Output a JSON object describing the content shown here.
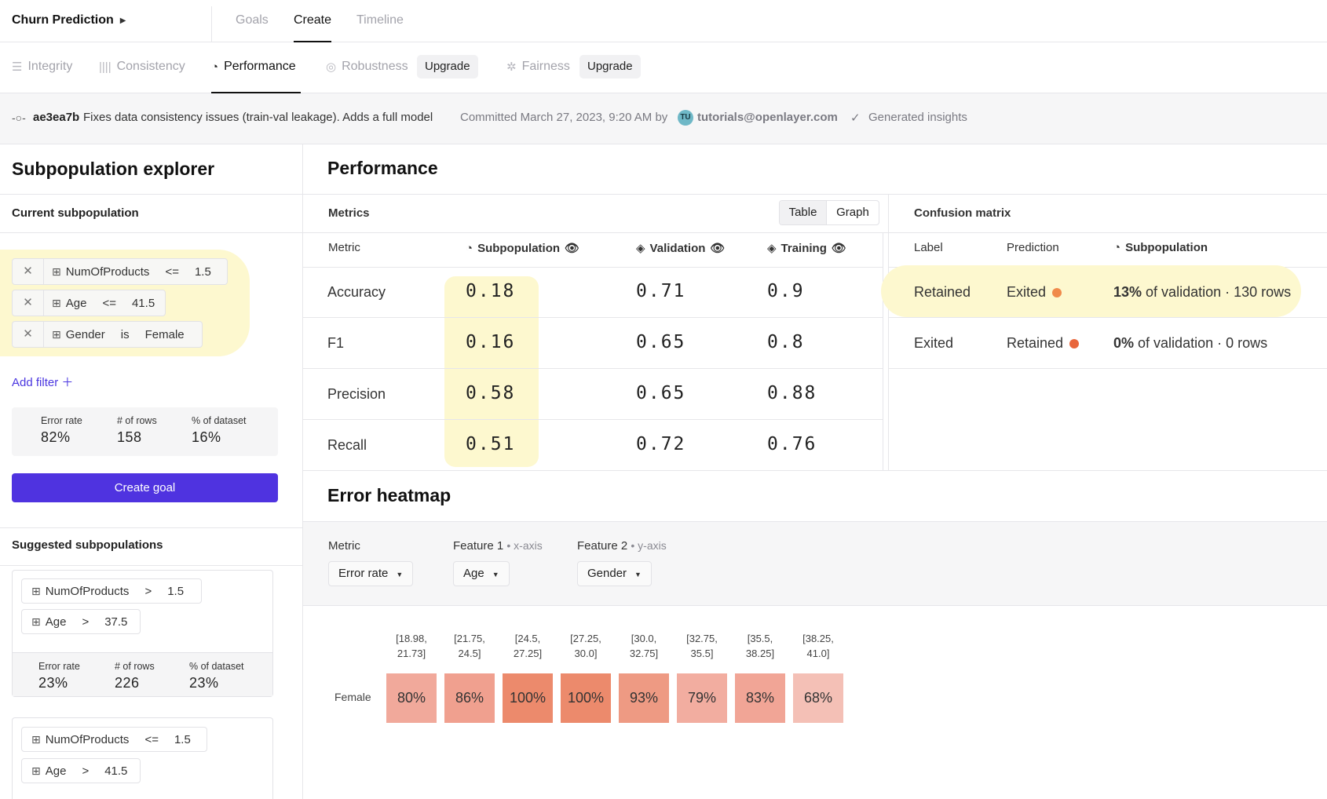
{
  "project": {
    "name": "Churn Prediction"
  },
  "top_tabs": [
    {
      "label": "Goals",
      "active": false
    },
    {
      "label": "Create",
      "active": true
    },
    {
      "label": "Timeline",
      "active": false
    }
  ],
  "sub_tabs": [
    {
      "label": "Integrity",
      "icon": "lines-icon",
      "active": false
    },
    {
      "label": "Consistency",
      "icon": "bars-icon",
      "active": false
    },
    {
      "label": "Performance",
      "icon": "pie-icon",
      "active": true
    },
    {
      "label": "Robustness",
      "icon": "target-icon",
      "active": false,
      "upgrade": "Upgrade"
    },
    {
      "label": "Fairness",
      "icon": "aperture-icon",
      "active": false,
      "upgrade": "Upgrade"
    }
  ],
  "commit": {
    "hash": "ae3ea7b",
    "message": "Fixes data consistency issues (train-val leakage). Adds a full model",
    "committed": "Committed March 27, 2023, 9:20 AM",
    "by": "by",
    "avatar_initials": "TU",
    "user": "tutorials@openlayer.com",
    "status": "Generated insights"
  },
  "left": {
    "title": "Subpopulation explorer",
    "current_label": "Current subpopulation",
    "filters": [
      {
        "feature": "NumOfProducts",
        "op": "<=",
        "value": "1.5"
      },
      {
        "feature": "Age",
        "op": "<=",
        "value": "41.5"
      },
      {
        "feature": "Gender",
        "op": "is",
        "value": "Female"
      }
    ],
    "add_filter": "Add filter",
    "stats": {
      "error_rate_label": "Error rate",
      "error_rate": "82%",
      "rows_label": "# of rows",
      "rows": "158",
      "pct_label": "% of dataset",
      "pct": "16%"
    },
    "create_goal": "Create goal",
    "suggested_label": "Suggested subpopulations",
    "suggested": [
      {
        "filters": [
          {
            "feature": "NumOfProducts",
            "op": ">",
            "value": "1.5"
          },
          {
            "feature": "Age",
            "op": ">",
            "value": "37.5"
          }
        ],
        "error_rate_label": "Error rate",
        "error_rate": "23%",
        "rows_label": "# of rows",
        "rows": "226",
        "pct_label": "% of dataset",
        "pct": "23%"
      },
      {
        "filters": [
          {
            "feature": "NumOfProducts",
            "op": "<=",
            "value": "1.5"
          },
          {
            "feature": "Age",
            "op": ">",
            "value": "41.5"
          }
        ]
      }
    ]
  },
  "performance": {
    "title": "Performance",
    "metrics_label": "Metrics",
    "toggle": {
      "table": "Table",
      "graph": "Graph"
    },
    "columns": {
      "metric": "Metric",
      "subpopulation": "Subpopulation",
      "validation": "Validation",
      "training": "Training"
    },
    "rows": [
      {
        "name": "Accuracy",
        "sub": "0.18",
        "val": "0.71",
        "train": "0.9"
      },
      {
        "name": "F1",
        "sub": "0.16",
        "val": "0.65",
        "train": "0.8"
      },
      {
        "name": "Precision",
        "sub": "0.58",
        "val": "0.65",
        "train": "0.88"
      },
      {
        "name": "Recall",
        "sub": "0.51",
        "val": "0.72",
        "train": "0.76"
      }
    ]
  },
  "confusion": {
    "title": "Confusion matrix",
    "columns": {
      "label": "Label",
      "prediction": "Prediction",
      "subpopulation": "Subpopulation"
    },
    "rows": [
      {
        "label": "Retained",
        "prediction": "Exited",
        "pct": "13%",
        "text": "of validation · 130 rows"
      },
      {
        "label": "Exited",
        "prediction": "Retained",
        "pct": "0%",
        "text": "of validation · 0 rows"
      }
    ]
  },
  "heatmap": {
    "title": "Error heatmap",
    "metric_label": "Metric",
    "metric_value": "Error rate",
    "feature1_label": "Feature 1",
    "feature1_axis": "• x-axis",
    "feature1_value": "Age",
    "feature2_label": "Feature 2",
    "feature2_axis": "• y-axis",
    "feature2_value": "Gender",
    "row_label": "Female",
    "bins": [
      [
        "[18.98,",
        "21.73]"
      ],
      [
        "[21.75,",
        "24.5]"
      ],
      [
        "[24.5,",
        "27.25]"
      ],
      [
        "[27.25,",
        "30.0]"
      ],
      [
        "[30.0,",
        "32.75]"
      ],
      [
        "[32.75,",
        "35.5]"
      ],
      [
        "[35.5,",
        "38.25]"
      ],
      [
        "[38.25,",
        "41.0]"
      ]
    ],
    "values": [
      "80%",
      "86%",
      "100%",
      "100%",
      "93%",
      "79%",
      "83%",
      "68%"
    ],
    "colors": [
      "#f1a99b",
      "#f0a08f",
      "#ec8a6c",
      "#ec8a6c",
      "#ee9a83",
      "#f2ada0",
      "#f1a596",
      "#f4c0b6"
    ]
  },
  "colors": {
    "accent": "#4f33e0",
    "highlight": "#fdf8cf",
    "orange_dot": "#f08a4b"
  }
}
